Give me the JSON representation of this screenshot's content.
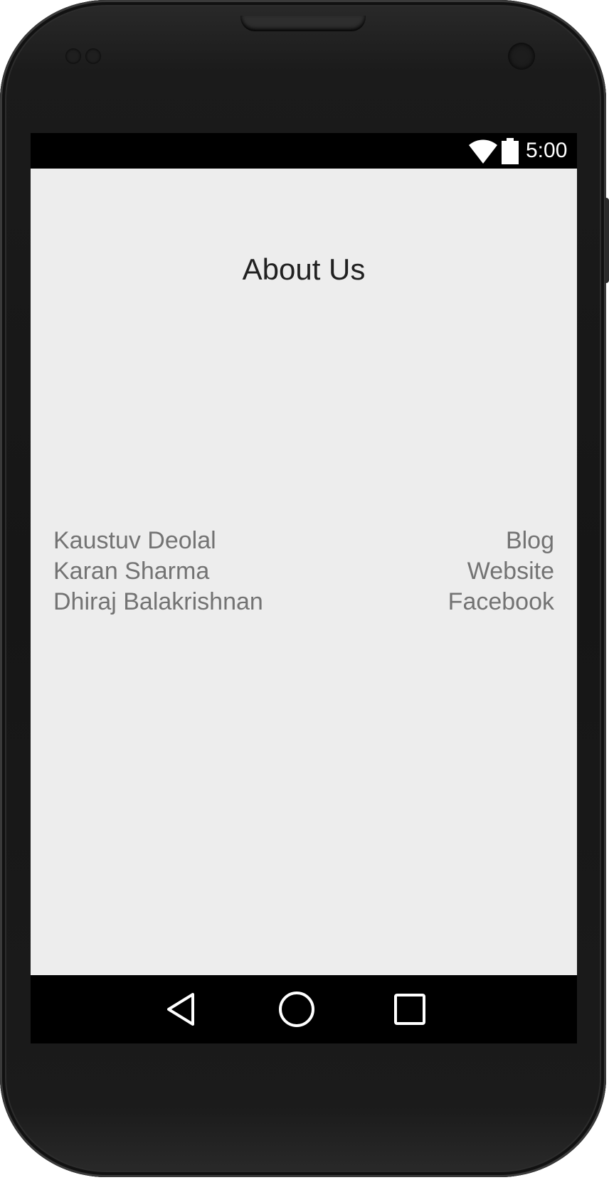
{
  "status_bar": {
    "time": "5:00",
    "wifi_icon": "wifi-icon",
    "battery_icon": "battery-icon"
  },
  "page": {
    "title": "About Us"
  },
  "team": {
    "names": [
      "Kaustuv Deolal",
      "Karan Sharma",
      "Dhiraj Balakrishnan"
    ],
    "links": [
      "Blog",
      "Website",
      "Facebook"
    ]
  },
  "nav_bar": {
    "back_icon": "back-triangle-icon",
    "home_icon": "home-circle-icon",
    "recents_icon": "recents-square-icon"
  },
  "colors": {
    "screen_background": "#ededed",
    "title_text": "#212121",
    "body_text": "#737373",
    "bars": "#000000"
  }
}
